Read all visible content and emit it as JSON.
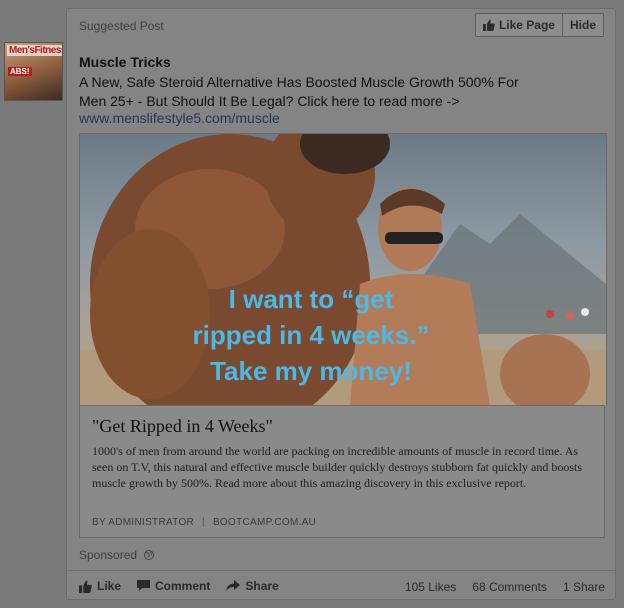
{
  "avatar": {
    "masthead": "Men'sFitness",
    "badge": "ABS!"
  },
  "post": {
    "suggested_label": "Suggested Post",
    "like_page_label": "Like Page",
    "hide_label": "Hide",
    "page_name": "Muscle Tricks",
    "text": "A New, Safe Steroid Alternative Has Boosted Muscle Growth 500% For Men 25+ - But Should It Be Legal? Click here to read more ->",
    "url": "www.menslifestyle5.com/muscle"
  },
  "hero": {
    "overlay_text": "I want to “get ripped in 4 weeks.” Take my money!"
  },
  "link": {
    "title": "\"Get Ripped in 4 Weeks\"",
    "description": "1000's of men from around the world are packing on incredible amounts of muscle in record time. As seen on T.V, this natural and effective muscle builder quickly destroys stubborn fat quickly and boosts muscle growth by 500%. Read more about this amazing discovery in this exclusive report.",
    "author": "BY ADMINISTRATOR",
    "domain": "BOOTCAMP.COM.AU"
  },
  "footer": {
    "sponsored_label": "Sponsored",
    "like_label": "Like",
    "comment_label": "Comment",
    "share_label": "Share",
    "likes_count": "105 Likes",
    "comments_count": "68 Comments",
    "shares_count": "1 Share"
  },
  "colors": {
    "overlay_text": "#4db7e6",
    "link_url": "#26355a",
    "page_background": "#7a7a7a"
  },
  "icons": [
    "thumbs-up-icon",
    "comment-icon",
    "share-icon",
    "globe-icon"
  ]
}
